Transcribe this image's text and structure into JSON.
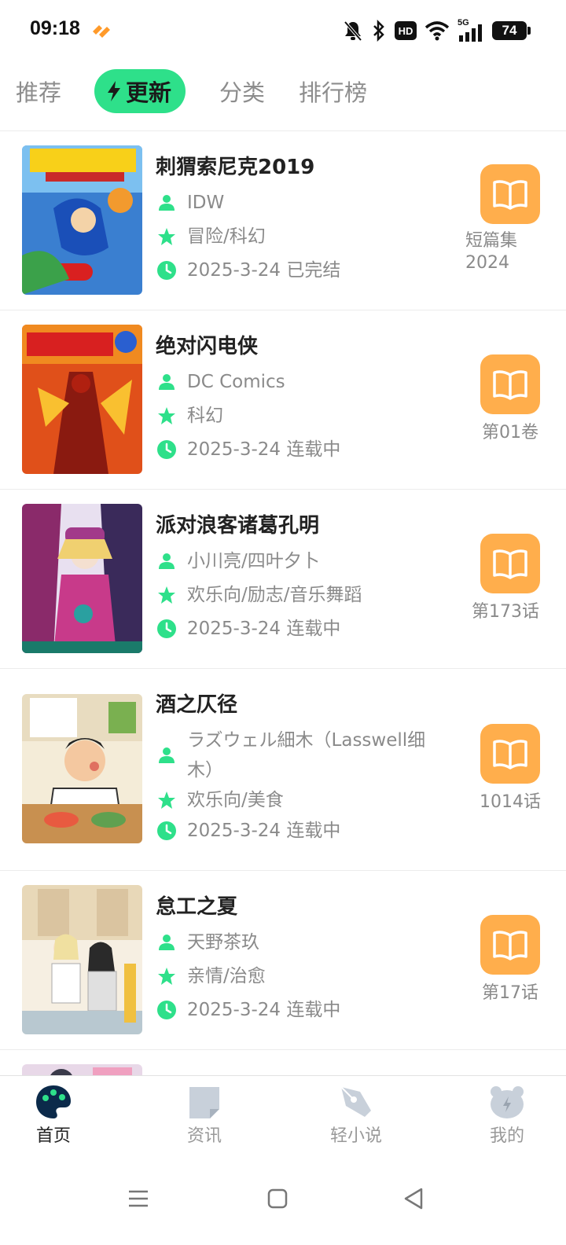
{
  "status_bar": {
    "time": "09:18",
    "network": "5G",
    "hd": "HD",
    "battery": "74"
  },
  "tabs": [
    {
      "label": "推荐",
      "active": false
    },
    {
      "label": "更新",
      "active": true,
      "icon": "lightning-icon"
    },
    {
      "label": "分类",
      "active": false
    },
    {
      "label": "排行榜",
      "active": false
    }
  ],
  "items": [
    {
      "title": "刺猬索尼克2019",
      "author": "IDW",
      "genres": "冒险/科幻",
      "date_status": "2025-3-24 已完结",
      "chapter": "短篇集\n2024"
    },
    {
      "title": "绝对闪电侠",
      "author": "DC Comics",
      "genres": "科幻",
      "date_status": "2025-3-24 连载中",
      "chapter": "第01卷"
    },
    {
      "title": "派对浪客诸葛孔明",
      "author": "小川亮/四叶夕卜",
      "genres": "欢乐向/励志/音乐舞蹈",
      "date_status": "2025-3-24 连载中",
      "chapter": "第173话"
    },
    {
      "title": "酒之仄径",
      "author": "ラズウェル細木（Lasswell细木）",
      "genres": "欢乐向/美食",
      "date_status": "2025-3-24 连载中",
      "chapter": "1014话"
    },
    {
      "title": "怠工之夏",
      "author": "天野茶玖",
      "genres": "亲情/治愈",
      "date_status": "2025-3-24 连载中",
      "chapter": "第17话"
    }
  ],
  "bottom_nav": [
    {
      "label": "首页",
      "active": true
    },
    {
      "label": "资讯",
      "active": false
    },
    {
      "label": "轻小说",
      "active": false
    },
    {
      "label": "我的",
      "active": false
    }
  ],
  "colors": {
    "accent": "#2ee08a",
    "read_button": "#ffae4c",
    "meta_icon": "#2ee08a"
  }
}
